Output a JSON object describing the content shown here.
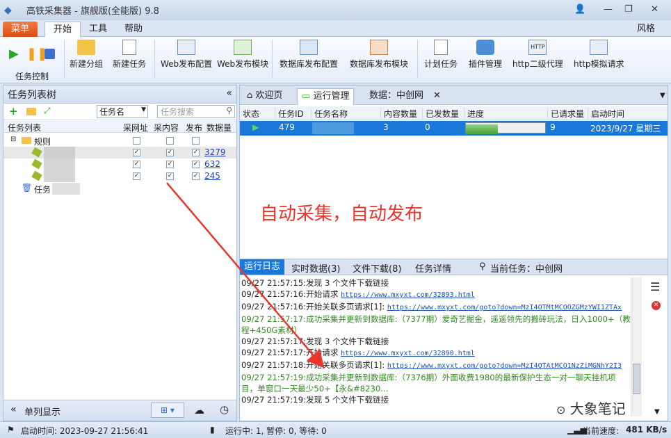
{
  "window": {
    "title": "高铁采集器 - 旗舰版(全能版) 9.8",
    "style_label": "风格"
  },
  "menu": {
    "menu_label": "菜单",
    "tabs": [
      "开始",
      "工具",
      "帮助"
    ]
  },
  "ribbon": {
    "group_label": "任务控制",
    "buttons": [
      "新建分组",
      "新建任务",
      "Web发布配置",
      "Web发布模块",
      "数据库发布配置",
      "数据库发布模块",
      "计划任务",
      "插件管理",
      "http二级代理",
      "http模拟请求"
    ]
  },
  "left": {
    "title": "任务列表树",
    "search_field": "任务名",
    "search_placeholder": "任务搜索",
    "headers": [
      "任务列表",
      "采网址",
      "采内容",
      "发布",
      "数据量"
    ],
    "root": "规则",
    "rows": [
      "3279",
      "632",
      "245"
    ],
    "trash": "任务",
    "toggle": "单列显示"
  },
  "right": {
    "tabs": [
      "欢迎页",
      "运行管理",
      "数据：中创网"
    ],
    "grid_headers": [
      "状态",
      "任务ID",
      "任务名称",
      "内容数量",
      "已发数量",
      "进度",
      "已请求量",
      "启动时间"
    ],
    "grid_row": {
      "id": "479",
      "content": "3",
      "sent": "0",
      "requested": "9",
      "start": "2023/9/27 星期三"
    },
    "progress": 0.4,
    "overlay": "自动采集，自动发布",
    "log_tabs": [
      "运行日志",
      "实时数据(3)",
      "文件下载(8)",
      "任务详情"
    ],
    "current_task": "当前任务：中创网",
    "log": [
      {
        "t": "09/27 21:57:15:发现 3 个文件下载链接",
        "c": "k"
      },
      {
        "t": "09/27 21:57:16:开始请求 ",
        "l": "https://www.mxyxt.com/32893.html",
        "c": "k"
      },
      {
        "t": "09/27 21:57:16:开始关联多页请求[1]: ",
        "l": "https://www.mxyxt.com/goto?down=MzI4OTMtMCOOZGMzYWI1ZTAx",
        "c": "k"
      },
      {
        "t": "09/27 21:57:17:成功采集并更新到数据库:（7377期）爱奇艺掘金，遥遥领先的搬砖玩法，日入1000+（教",
        "c": "g"
      },
      {
        "t": "程+450G素材）",
        "c": "g"
      },
      {
        "t": "09/27 21:57:17:发现 3 个文件下载链接",
        "c": "k"
      },
      {
        "t": "09/27 21:57:17:开始请求 ",
        "l": "https://www.mxyxt.com/32890.html",
        "c": "k"
      },
      {
        "t": "09/27 21:57:18:开始关联多页请求[1]: ",
        "l": "https://www.mxyxt.com/goto?down=MzI4OTAtMCO1NzZiMGNhY2I3",
        "c": "k"
      },
      {
        "t": "09/27 21:57:19:成功采集并更新到数据库:（7376期）外面收费1980的最新保护生态一对一聊天挂机项",
        "c": "g"
      },
      {
        "t": "目，单窗口一天最少50+【永&#8230...",
        "c": "g"
      },
      {
        "t": "09/27 21:57:19:发现 5 个文件下载链接",
        "c": "k"
      }
    ]
  },
  "status": {
    "start_time": "启动时间: 2023-09-27 21:56:41",
    "running": "运行中: 1, 暂停: 0, 等待: 0",
    "speed_label": "当前速度:",
    "speed": "481 KB/s"
  },
  "watermark": "大象笔记"
}
